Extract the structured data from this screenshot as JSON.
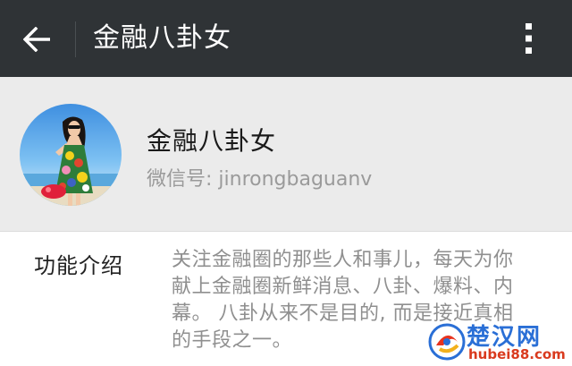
{
  "appbar": {
    "title": "金融八卦女",
    "back_icon": "arrow-left-icon",
    "more_icon": "more-vertical-icon"
  },
  "profile": {
    "name": "金融八卦女",
    "wechat_id": "微信号: jinrongbaguanv"
  },
  "intro": {
    "label": "功能介绍",
    "lines": [
      "关注金融圈的那些人和事儿，每天为你",
      "献上金融圈新鲜消息、八卦、爆料、内",
      "幕。 八卦从来不是目的, 而是接近真相",
      "的手段之一。"
    ]
  },
  "watermark": {
    "name": "楚汉网",
    "domain": "hubei88.com"
  },
  "colors": {
    "appbar_bg": "#2f3336",
    "page_bg": "#ebebeb",
    "card_bg": "#ffffff",
    "muted_text": "#8f8f8f"
  }
}
